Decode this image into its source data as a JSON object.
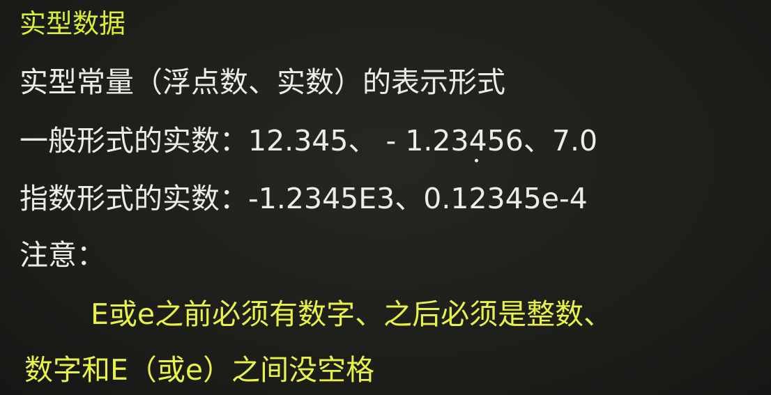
{
  "slide": {
    "title": "实型数据",
    "lines": [
      "实型常量（浮点数、实数）的表示形式",
      "一般形式的实数：12.345、 - 1.23456、7.0",
      "指数形式的实数：-1.2345E3、0.12345e-4",
      "注意：",
      "E或e之前必须有数字、之后必须是整数、",
      "数字和E（或e）之间没空格"
    ]
  },
  "colors": {
    "background": "#1f1f1c",
    "body_text": "#ecece8",
    "highlight_text": "#e8f24a"
  }
}
